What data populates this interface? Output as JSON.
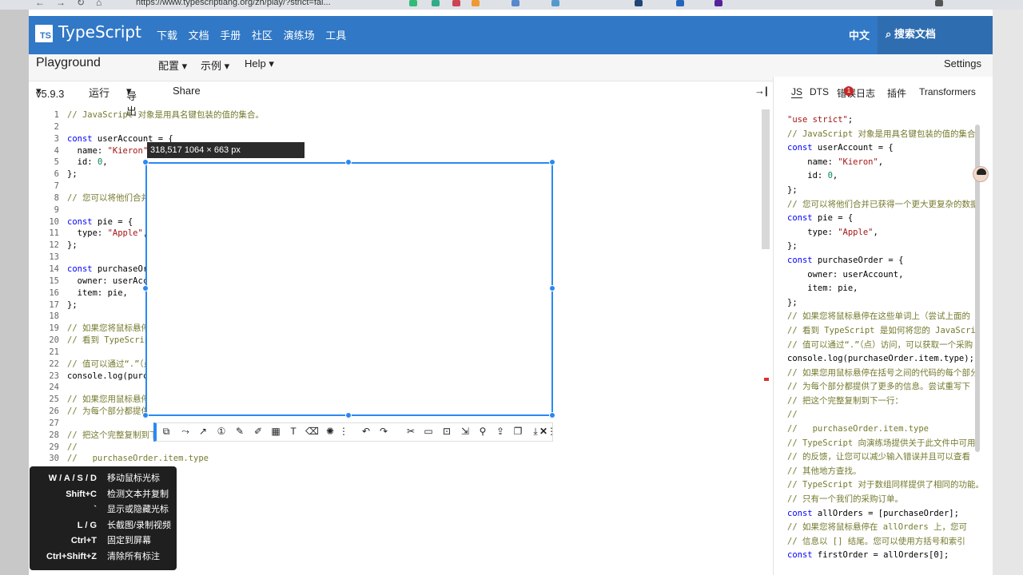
{
  "browser": {
    "url": "https://www.typescriptlang.org/zh/play/?strict=fal..."
  },
  "nav": {
    "logo_box": "TS",
    "brand": "TypeScript",
    "links": [
      "下载",
      "文档",
      "手册",
      "社区",
      "演练场",
      "工具"
    ],
    "language": "中文",
    "search": "搜索文档"
  },
  "playground": {
    "title": "Playground",
    "menu": [
      "配置",
      "示例",
      "Help"
    ],
    "settings": "Settings"
  },
  "editor_bar": {
    "version": "v5.9.3",
    "run": "运行",
    "export": "导出",
    "share": "Share",
    "collapse_icon": "→|"
  },
  "right_tabs": [
    "JS",
    "DTS",
    "错误",
    "日志",
    "插件",
    "Transformers"
  ],
  "error_count": "1",
  "line_numbers": [
    "1",
    "2",
    "3",
    "4",
    "5",
    "6",
    "7",
    "8",
    "9",
    "10",
    "11",
    "12",
    "13",
    "14",
    "15",
    "16",
    "17",
    "18",
    "19",
    "20",
    "21",
    "22",
    "23",
    "24",
    "25",
    "26",
    "27",
    "28",
    "29",
    "30"
  ],
  "code_lines": [
    "// JavaScript 对象是用具名键包装的值的集合。",
    "",
    "const userAccount = {",
    "  name: \"Kieron\",",
    "  id: 0,",
    "};",
    "",
    "// 您可以将他们合并已获得一个更大更复杂的数据模型。",
    "",
    "const pie = {",
    "  type: \"Apple\",",
    "};",
    "",
    "const purchaseOrder = {",
    "  owner: userAccount,",
    "  item: pie,",
    "};",
    "",
    "// 如果您将鼠标悬停在这些单词上（尝试上面的 purchaseOrder），您可以",
    "// 看到 TypeScript 是如何将您的 JavaScript 解释为被标记的类型。",
    "",
    "// 值可以通过“.”（点）访问，可以获取一个采购订单的用户名：",
    "console.log(purchaseOrder.item.type);",
    "",
    "// 如果您用鼠标悬停在括号之间的代码的每个部分上，您可以看到 TypeScript",
    "// 为每个部分都提供了更多的信息。尝试重写下面的内容：",
    "",
    "// 把这个完整复制到下一行：",
    "//",
    "//   purchaseOrder.item.type",
    "//   TypeScript 向演练场提供关于此文件中可用的 JavaScript 对象",
    "// 的反馈，让您可以减少输入错误并且可以查看额外的信息，而不必在",
    "// 其他地方查找。",
    "",
    "// TypeScript 对于数组同样提供了相同的功能。这里有一个数组，其中",
    "// 只有一个我们的采购订单。"
  ],
  "output_lines": [
    "\"use strict\";",
    "// JavaScript 对象是用具名键包装的值的集合。",
    "const userAccount = {",
    "    name: \"Kieron\",",
    "    id: 0,",
    "};",
    "// 您可以将他们合并已获得一个更大更复杂的数据模型。",
    "const pie = {",
    "    type: \"Apple\",",
    "};",
    "const purchaseOrder = {",
    "    owner: userAccount,",
    "    item: pie,",
    "};",
    "// 如果您将鼠标悬停在这些单词上（尝试上面的",
    "// 看到 TypeScript 是如何将您的 JavaScript",
    "// 值可以通过“.”（点）访问，可以获取一个采购",
    "console.log(purchaseOrder.item.type);",
    "// 如果您用鼠标悬停在括号之间的代码的每个部分",
    "// 为每个部分都提供了更多的信息。尝试重写下",
    "// 把这个完整复制到下一行：",
    "//",
    "//   purchaseOrder.item.type",
    "// TypeScript 向演练场提供关于此文件中可用的",
    "// 的反馈，让您可以减少输入错误并且可以查看",
    "// 其他地方查找。",
    "// TypeScript 对于数组同样提供了相同的功能。",
    "// 只有一个我们的采购订单。",
    "const allOrders = [purchaseOrder];",
    "// 如果您将鼠标悬停在 allOrders 上，您可",
    "// 信息以 [] 结尾。您可以使用方括号和索引",
    "const firstOrder = allOrders[0];"
  ],
  "capture": {
    "info": "318,517  1064 × 663  px",
    "tool_icons": [
      "shape-icon",
      "path-icon",
      "arrow-icon",
      "number-icon",
      "pen-icon",
      "marker-icon",
      "mosaic-icon",
      "text-icon",
      "eraser-icon",
      "light-icon",
      "more-icon",
      "undo-icon",
      "redo-icon",
      "cut-icon",
      "record-icon",
      "ocr-icon",
      "scroll-capture-icon",
      "pin-icon",
      "upload-icon",
      "copy-icon",
      "download-icon",
      "close-icon",
      "menu-icon"
    ]
  },
  "shortcuts": [
    {
      "key": "W / A / S / D",
      "desc": "移动鼠标光标"
    },
    {
      "key": "Shift+C",
      "desc": "检测文本并复制"
    },
    {
      "key": "`",
      "desc": "显示或隐藏光标"
    },
    {
      "key": "L / G",
      "desc": "长截图/录制视频"
    },
    {
      "key": "Ctrl+T",
      "desc": "固定到屏幕"
    },
    {
      "key": "Ctrl+Shift+Z",
      "desc": "清除所有标注"
    }
  ],
  "colors": {
    "brand": "#3178c6",
    "capture_accent": "#2a88f4",
    "comment": "#767a2e",
    "keyword": "#0000ff",
    "string": "#a31515",
    "number": "#098658"
  }
}
